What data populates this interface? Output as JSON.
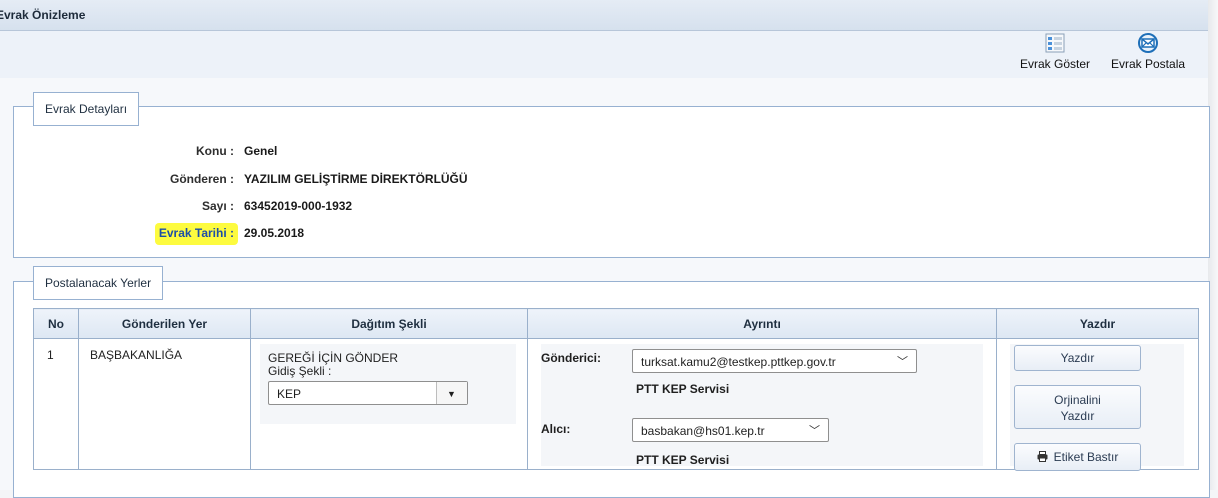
{
  "window": {
    "title": "Evrak Önizleme"
  },
  "toolbar": {
    "items": [
      {
        "label": "Evrak Göster",
        "icon": "document-list-icon"
      },
      {
        "label": "Evrak Postala",
        "icon": "envelope-icon"
      }
    ]
  },
  "details": {
    "legend": "Evrak Detayları",
    "rows": [
      {
        "label": "Konu :",
        "value": "Genel"
      },
      {
        "label": "Gönderen :",
        "value": "YAZILIM GELİŞTİRME DİREKTÖRLÜĞÜ"
      },
      {
        "label": "Sayı :",
        "value": "63452019-000-1932"
      },
      {
        "label": "Evrak Tarihi :",
        "value": "29.05.2018",
        "highlighted": true,
        "highlight_color": "#fdfb3f"
      }
    ]
  },
  "postal": {
    "legend": "Postalanacak Yerler",
    "columns": [
      "No",
      "Gönderilen Yer",
      "Dağıtım Şekli",
      "Ayrıntı",
      "Yazdır"
    ],
    "rows": [
      {
        "no": "1",
        "place": "BAŞBAKANLIĞA",
        "distribution": {
          "title": "GEREĞİ İÇİN GÖNDER",
          "method_label": "Gidiş Şekli :",
          "method_value": "KEP"
        },
        "detail": {
          "sender_label": "Gönderici:",
          "sender_value": "turksat.kamu2@testkep.pttkep.gov.tr",
          "sender_service": "PTT KEP Servisi",
          "receiver_label": "Alıcı:",
          "receiver_value": "basbakan@hs01.kep.tr",
          "receiver_service": "PTT KEP Servisi"
        },
        "print": {
          "print_label": "Yazdır",
          "original_line1": "Orjinalini",
          "original_line2": "Yazdır",
          "label_print": "Etiket Bastır"
        }
      }
    ]
  }
}
